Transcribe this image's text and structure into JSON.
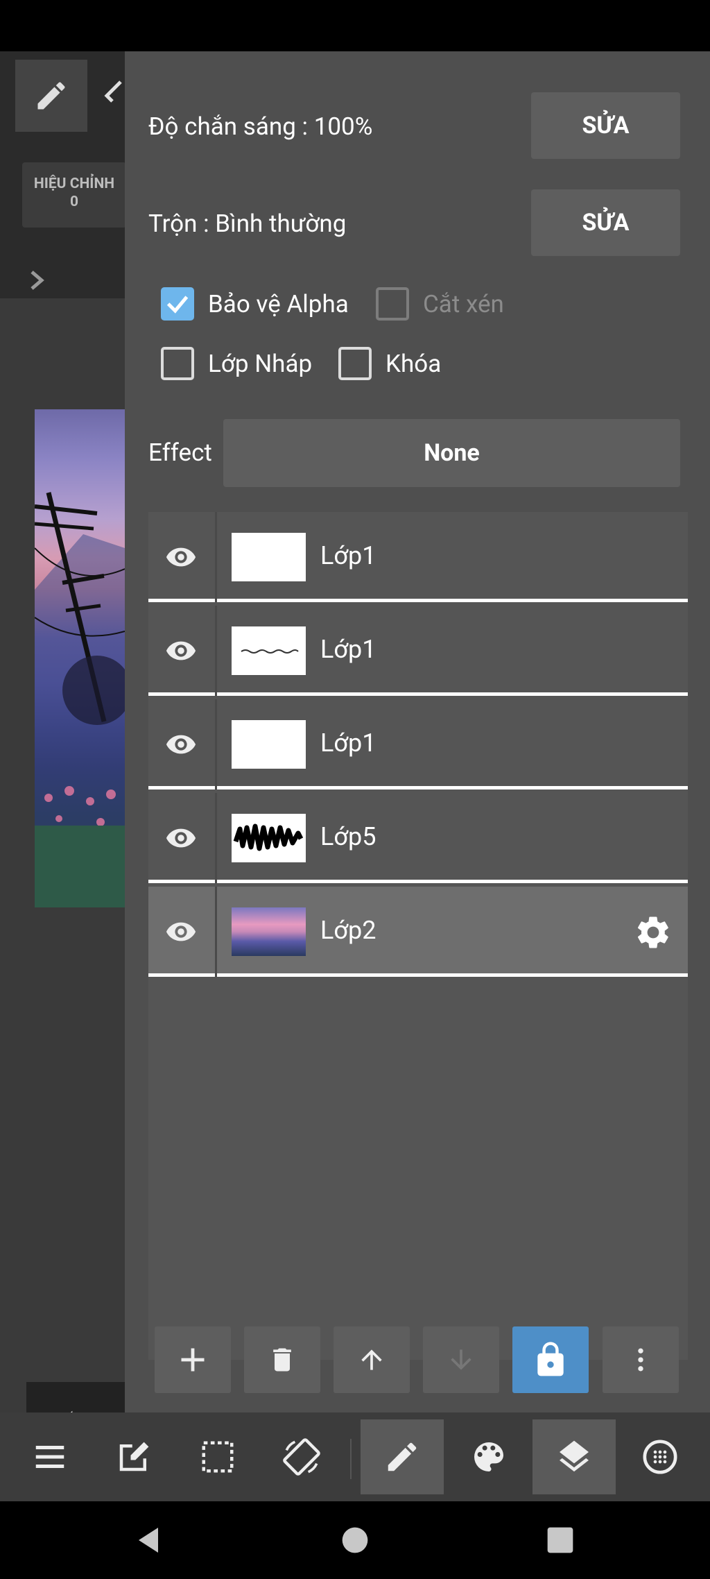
{
  "left_panel": {
    "correction_label": "HIỆU CHỈNH",
    "correction_value": "0"
  },
  "properties": {
    "opacity_label": "Độ chắn sáng : 100%",
    "blend_label": "Trộn : Bình thường",
    "edit_label": "SỬA",
    "alpha_protect_label": "Bảo vệ Alpha",
    "alpha_protect_checked": true,
    "clipping_label": "Cắt xén",
    "clipping_checked": false,
    "draft_label": "Lớp Nháp",
    "draft_checked": false,
    "lock_label": "Khóa",
    "lock_checked": false,
    "effect_label": "Effect",
    "effect_value": "None"
  },
  "layers": [
    {
      "name": "Lớp1",
      "thumb": "blank",
      "visible": true,
      "selected": false
    },
    {
      "name": "Lớp1",
      "thumb": "text",
      "visible": true,
      "selected": false
    },
    {
      "name": "Lớp1",
      "thumb": "blank",
      "visible": true,
      "selected": false
    },
    {
      "name": "Lớp5",
      "thumb": "scribble",
      "visible": true,
      "selected": false
    },
    {
      "name": "Lớp2",
      "thumb": "photo",
      "visible": true,
      "selected": true
    }
  ],
  "layer_actions": [
    "add-icon",
    "trash-icon",
    "arrow-up-icon",
    "arrow-down-icon",
    "lock-icon",
    "more-vertical-icon"
  ],
  "toolbar": [
    "menu-icon",
    "edit-note-icon",
    "selection-icon",
    "rotate-screen-icon",
    "pen-icon",
    "palette-icon",
    "layers-icon",
    "grid-circle-icon"
  ],
  "colors": {
    "accent": "#6eb6ec",
    "active_action": "#4e8fc8",
    "panel": "#4f4f4f"
  }
}
